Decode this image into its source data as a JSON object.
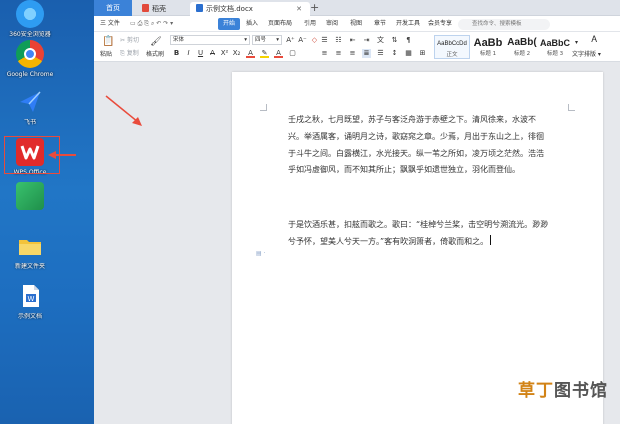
{
  "desktop": {
    "icons": [
      {
        "label": "360安全浏览器",
        "color": "#2e9cf2",
        "icon": "browser-icon"
      },
      {
        "label": "Google Chrome",
        "color": "#e94235",
        "icon": "chrome-icon"
      },
      {
        "label": "飞书",
        "color": "#2f7df6",
        "icon": "feishu-icon"
      },
      {
        "label": "WPS Office",
        "color": "#e12b2b",
        "icon": "wps-icon"
      },
      {
        "label": "",
        "color": "#1f8f4a",
        "icon": "app-icon"
      },
      {
        "label": "新建文件夹",
        "color": "#f3c33a",
        "icon": "folder-icon"
      },
      {
        "label": "示例文档",
        "color": "#2b6fcf",
        "icon": "doc-file-icon"
      }
    ]
  },
  "window": {
    "tabs": [
      {
        "label": "首页"
      },
      {
        "label": "稻壳"
      },
      {
        "label": "示例文档.docx"
      }
    ],
    "menu": {
      "file": "三 文件",
      "start": "开始",
      "items": [
        "插入",
        "页面布局",
        "引用",
        "审阅",
        "视图",
        "章节",
        "开发工具",
        "会员专享"
      ],
      "search_placeholder": "查找命令、搜索模板"
    },
    "ribbon": {
      "paste": "粘贴",
      "cut": "剪切",
      "copy": "复制",
      "format_painter": "格式刷",
      "font_name": "宋体",
      "font_size": "四号",
      "styles": [
        {
          "sample": "AaBbCcDd",
          "name": "正文"
        },
        {
          "sample": "AaBb",
          "name": "标题 1"
        },
        {
          "sample": "AaBb(",
          "name": "标题 2"
        },
        {
          "sample": "AaBbC",
          "name": "标题 3"
        }
      ],
      "text_layout": "文字排版"
    }
  },
  "document": {
    "paragraphs": [
      "壬戌之秋，七月既望，苏子与客泛舟游于赤壁之下。清风徐来，水波不兴。举酒属客，诵明月之诗，歌窈窕之章。少焉，月出于东山之上，徘徊于斗牛之间。白露横江，水光接天。纵一苇之所如，凌万顷之茫然。浩浩乎如冯虚御风，而不知其所止；飘飘乎如遗世独立，羽化而登仙。",
      "于是饮酒乐甚，扣舷而歌之。歌曰：“桂棹兮兰桨，击空明兮溯流光。渺渺兮予怀，望美人兮天一方。”客有吹洞箫者，倚歌而和之。"
    ]
  },
  "watermark": {
    "part1": "草丁",
    "part2": "图书馆"
  }
}
